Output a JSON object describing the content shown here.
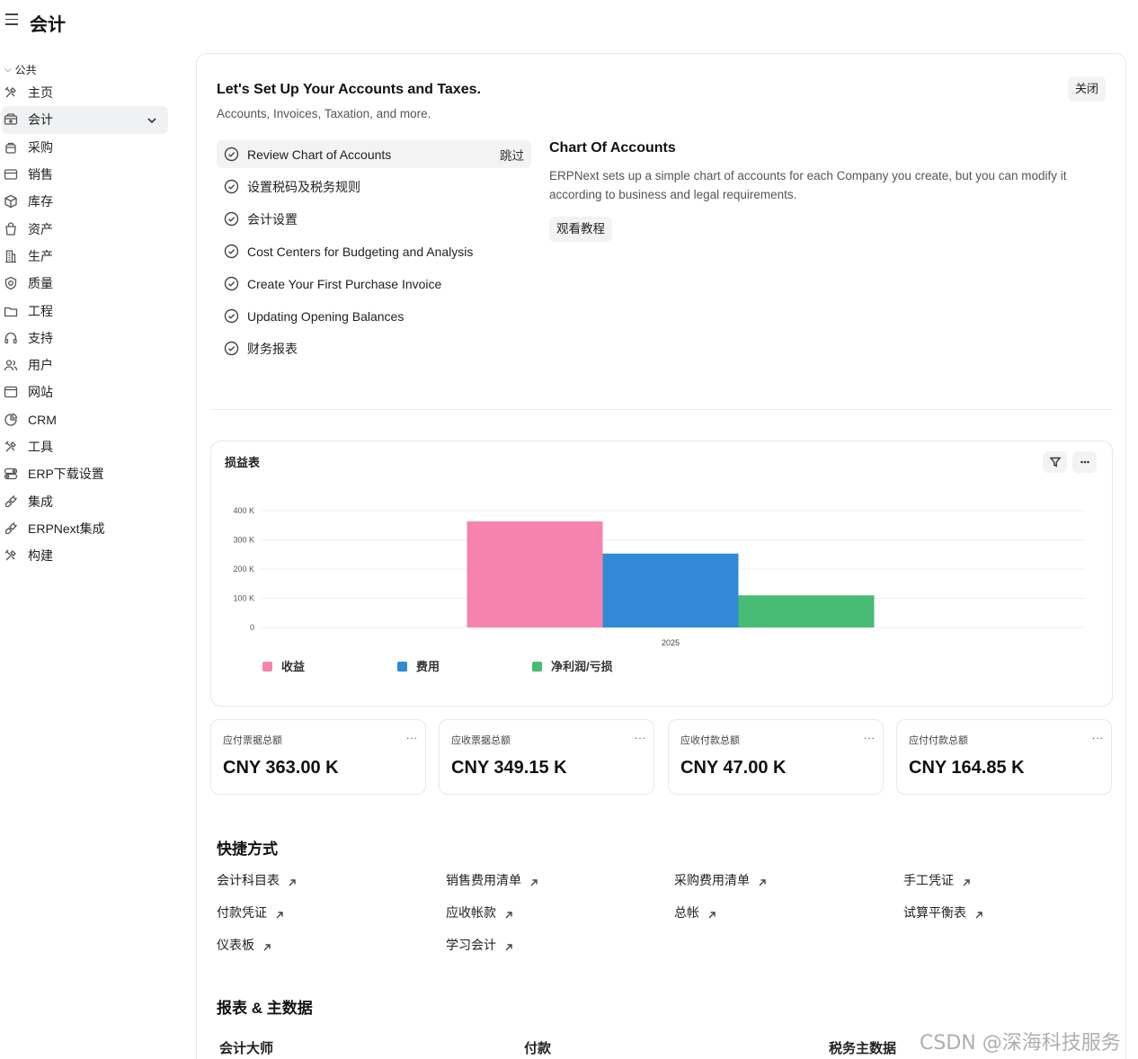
{
  "header": {
    "title": "会计"
  },
  "sidebar": {
    "section": "公共",
    "items": [
      {
        "label": "主页",
        "icon": "tools-icon"
      },
      {
        "label": "会计",
        "icon": "wallet-icon",
        "active": true
      },
      {
        "label": "采购",
        "icon": "cart-icon"
      },
      {
        "label": "销售",
        "icon": "card-icon"
      },
      {
        "label": "库存",
        "icon": "box-icon"
      },
      {
        "label": "资产",
        "icon": "bag-icon"
      },
      {
        "label": "生产",
        "icon": "building-icon"
      },
      {
        "label": "质量",
        "icon": "shield-icon"
      },
      {
        "label": "工程",
        "icon": "folder-icon"
      },
      {
        "label": "支持",
        "icon": "headset-icon"
      },
      {
        "label": "用户",
        "icon": "users-icon"
      },
      {
        "label": "网站",
        "icon": "browser-icon"
      },
      {
        "label": "CRM",
        "icon": "pie-icon"
      },
      {
        "label": "工具",
        "icon": "tools-icon"
      },
      {
        "label": "ERP下载设置",
        "icon": "toggle-icon"
      },
      {
        "label": "集成",
        "icon": "plug-icon"
      },
      {
        "label": "ERPNext集成",
        "icon": "plug-icon"
      },
      {
        "label": "构建",
        "icon": "tools-icon"
      }
    ]
  },
  "onboarding": {
    "title": "Let's Set Up Your Accounts and Taxes.",
    "subtitle": "Accounts, Invoices, Taxation, and more.",
    "close_label": "关闭",
    "skip_label": "跳过",
    "steps": [
      "Review Chart of Accounts",
      "设置税码及税务规则",
      "会计设置",
      "Cost Centers for Budgeting and Analysis",
      "Create Your First Purchase Invoice",
      "Updating Opening Balances",
      "财务报表"
    ],
    "detail": {
      "title": "Chart Of Accounts",
      "body": "ERPNext sets up a simple chart of accounts for each Company you create, but you can modify it according to business and legal requirements.",
      "button": "观看教程"
    }
  },
  "chart_data": {
    "type": "bar",
    "title": "损益表",
    "categories": [
      "2025"
    ],
    "ylim": [
      0,
      400000
    ],
    "yticks": [
      0,
      100000,
      200000,
      300000,
      400000
    ],
    "ytick_labels": [
      "0",
      "100 K",
      "200 K",
      "300 K",
      "400 K"
    ],
    "grid": true,
    "legend_position": "bottom-left",
    "series": [
      {
        "name": "收益",
        "values": [
          363000
        ],
        "color": "#f683ae"
      },
      {
        "name": "费用",
        "values": [
          253000
        ],
        "color": "#318ad8"
      },
      {
        "name": "净利润/亏损",
        "values": [
          110000
        ],
        "color": "#48bb74"
      }
    ]
  },
  "number_cards": [
    {
      "label": "应付票据总额",
      "value": "CNY 363.00 K"
    },
    {
      "label": "应收票据总额",
      "value": "CNY 349.15 K"
    },
    {
      "label": "应收付款总额",
      "value": "CNY 47.00 K"
    },
    {
      "label": "应付付款总额",
      "value": "CNY 164.85 K"
    }
  ],
  "number_card_menu": "...",
  "shortcuts": {
    "title": "快捷方式",
    "items": [
      "会计科目表",
      "销售费用清单",
      "采购费用清单",
      "手工凭证",
      "付款凭证",
      "应收帐款",
      "总帐",
      "试算平衡表",
      "仪表板",
      "学习会计"
    ]
  },
  "reports": {
    "title": "报表 & 主数据",
    "columns": [
      "会计大师",
      "付款",
      "税务主数据"
    ]
  },
  "watermark": "CSDN @深海科技服务"
}
